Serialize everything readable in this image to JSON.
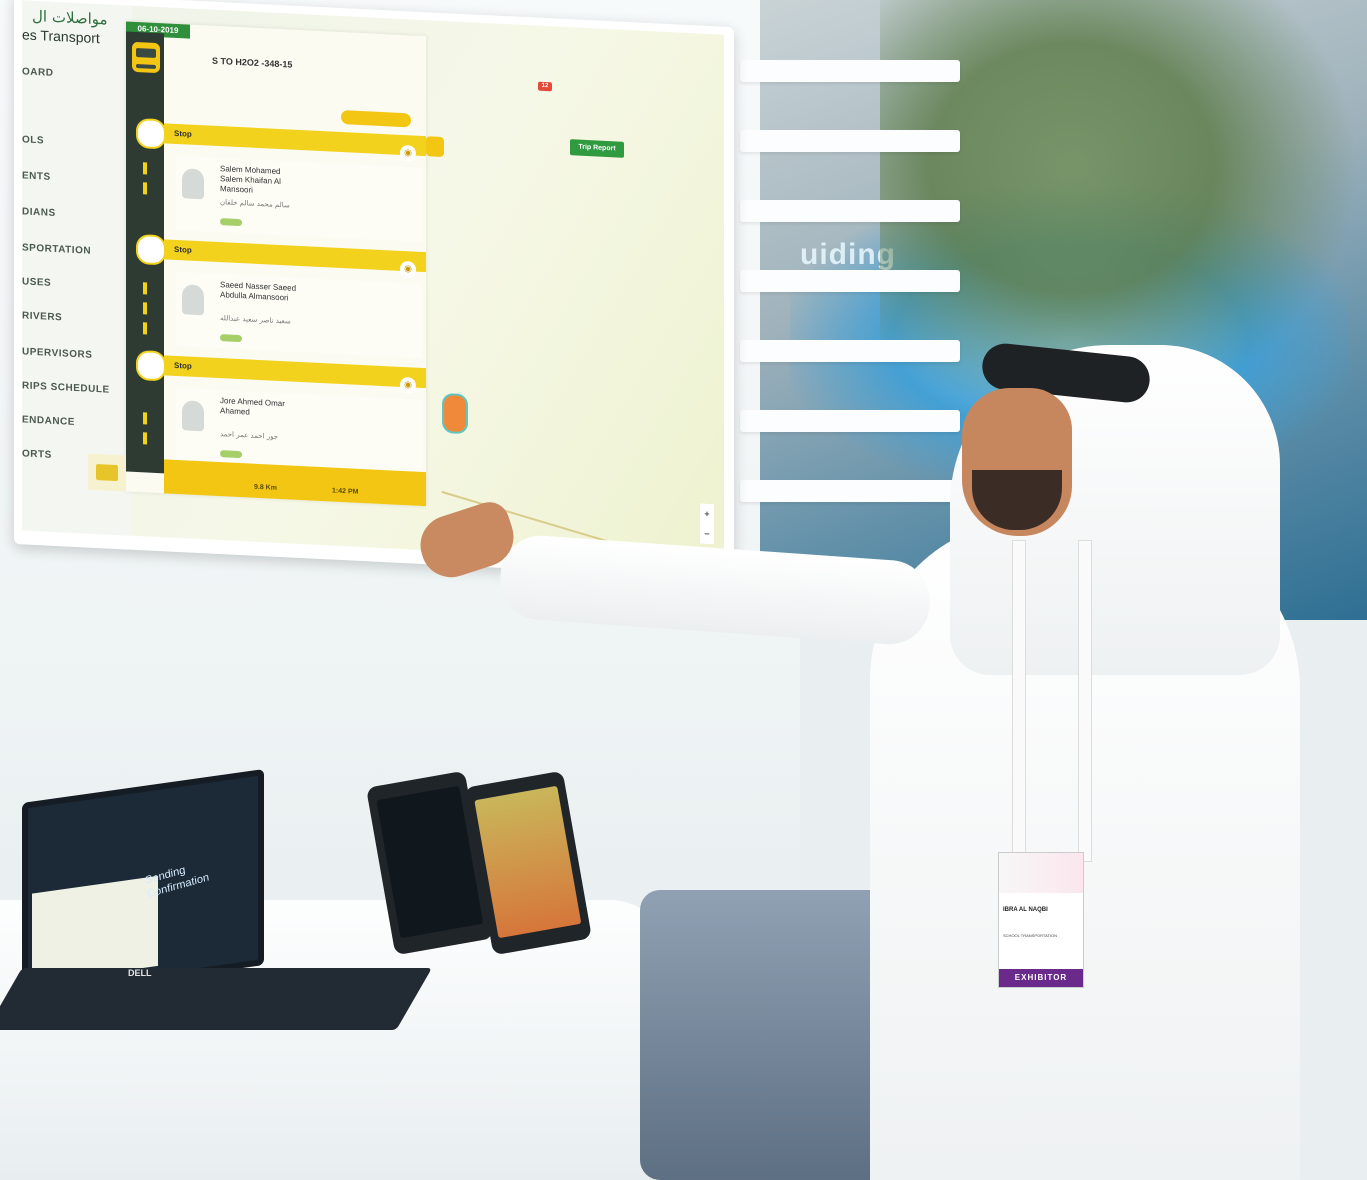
{
  "monitor": {
    "brand": {
      "arabic": "مواصلات ال",
      "name": "es Transport"
    },
    "nav_items": [
      "OARD",
      "OLS",
      "ENTS",
      "DIANS",
      "SPORTATION",
      "USES",
      "RIVERS",
      "UPERVISORS",
      "RIPS SCHEDULE",
      "ENDANCE",
      "ORTS"
    ],
    "trip": {
      "date": "06-10-2019",
      "route_id": "S TO H2O2 -348-15",
      "stops": [
        {
          "label": "Stop",
          "student": {
            "name": "Salem Mohamed Salem Khaifan Al Mansoori",
            "arabic": "سالم محمد سالم خلفان"
          }
        },
        {
          "label": "Stop",
          "student": {
            "name": "Saeed Nasser Saeed Abdulla Almansoori",
            "arabic": "سعيد ناصر سعيد عبدالله"
          }
        },
        {
          "label": "Stop",
          "student": {
            "name": "Jore Ahmed Omar Ahamed",
            "arabic": "جور احمد عمر احمد"
          }
        }
      ],
      "footer": {
        "distance": "9.8 Km",
        "time": "1:42 PM"
      }
    },
    "notifications_count": "12",
    "trip_report_label": "Trip Report"
  },
  "laptop": {
    "text": [
      "Sending",
      "Confirmation"
    ],
    "brand": "DELL"
  },
  "badge": {
    "name": "IBRA     AL NAQBI",
    "role": "SCHOOL TRANSPORTATION",
    "footer": "EXHIBITOR"
  },
  "background": {
    "hall_text": "uiding"
  }
}
